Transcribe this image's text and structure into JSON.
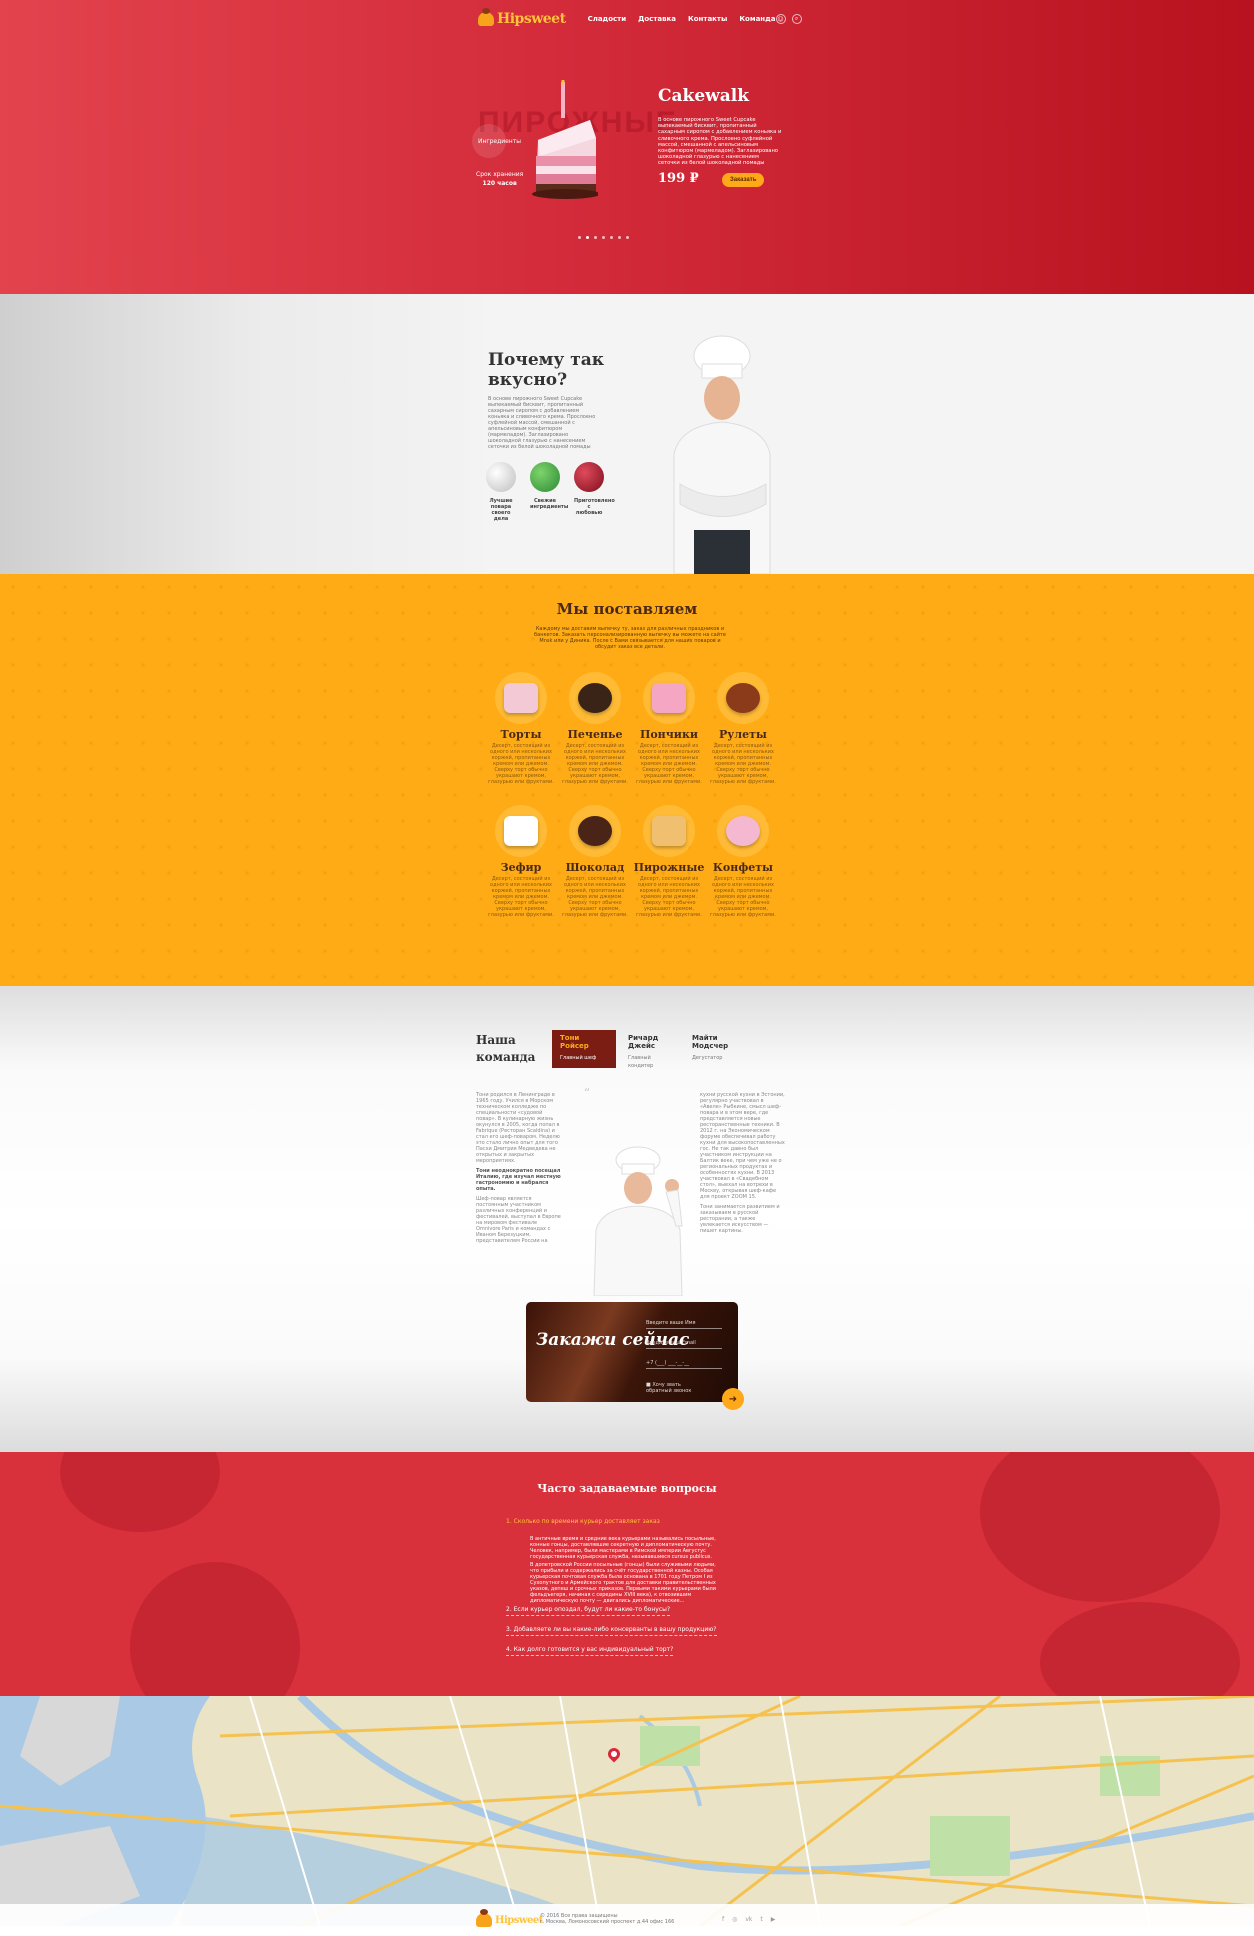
{
  "brand": {
    "name": "Hipsweet",
    "accent": "#ffa91a",
    "red": "#d32b3a",
    "orange": "#ffab16"
  },
  "nav": {
    "items": [
      "Сладости",
      "Доставка",
      "Контакты",
      "Команда"
    ],
    "icons": [
      "user-icon",
      "search-icon"
    ]
  },
  "hero": {
    "ghost_word": "ПИРОЖНЫЕ",
    "ingredients_label": "Ингредиенты",
    "shelf_label": "Срок хранения",
    "shelf_value": "120 часов",
    "title": "Cakewalk",
    "description": "В основе пирожного Sweet Cupcake выпекаемый бисквит, пропитанный сахарным сиропом с добавлением коньяка и сливочного крема. Прослоено суфлейной массой, смешанной с апельсиновым конфитюром (мармеладом). Заглазировано шоколадной глазурью с нанесением сеточки из белой шоколадной помады",
    "price": "199",
    "currency": "₽",
    "order_button": "Заказать",
    "slides": 7,
    "active_slide": 2
  },
  "why": {
    "title": "Почему так вкусно?",
    "text": "В основе пирожного Sweet Cupcake выпекаемый бисквит, пропитанный сахарным сиропом с добавлением коньяка и сливочного крема. Прослоено суфлейной массой, смешанной с апельсиновым конфитюром (мармеладом). Заглазировано шоколадной глазурью с нанесением сеточки из белой шоколадной помады",
    "features": [
      {
        "label": "Лучшие повара своего дела",
        "icon": "chef-hat-icon",
        "color": "#d7d7d7"
      },
      {
        "label": "Свежие ингредиенты",
        "icon": "leaf-icon",
        "color": "#3fae49"
      },
      {
        "label": "Приготовлено с любовью",
        "icon": "berry-icon",
        "color": "#a31a2a"
      }
    ]
  },
  "supply": {
    "title": "Мы поставляем",
    "subtitle": "Каждому мы доставим выпечку ту, заказ для различных праздников и банкетов. Заказать персонализированную выпечку вы можете на сайте Mnsk или у Диника. После с Вами связывается для наших поваров и обсудит заказ все детали.",
    "item_desc": "Десерт, состоящий из одного или нескольких коржей, пропитанных кремом или джемом. Сверху торт обычно украшают кремом, глазурью или фруктами.",
    "items": [
      {
        "name": "Торты",
        "icon": "cake-slice-icon"
      },
      {
        "name": "Печенье",
        "icon": "cookie-icon"
      },
      {
        "name": "Пончики",
        "icon": "donut-icon"
      },
      {
        "name": "Рулеты",
        "icon": "roll-icon"
      },
      {
        "name": "Зефир",
        "icon": "marshmallow-icon"
      },
      {
        "name": "Шоколад",
        "icon": "chocolate-icon"
      },
      {
        "name": "Пирожные",
        "icon": "cupcake-icon"
      },
      {
        "name": "Конфеты",
        "icon": "candy-icon"
      }
    ]
  },
  "team": {
    "title": "Наша команда",
    "members": [
      {
        "name": "Тони Ройсер",
        "role": "Главный шеф"
      },
      {
        "name": "Ричард Джейс",
        "role": "Главный кондитер"
      },
      {
        "name": "Майти Модсчер",
        "role": "Дегустатор"
      }
    ],
    "bio_left": "Тони родился в Ленинграде в 1965 году. Учился в Морском техническом колледже по специальности «судовой повар». В кулинарную жизнь окунулся в 2005, когда попал в Fabrique (Ресторан Scaldina) и стал его шеф-поваром. Неделю это стало лично опыт для того Пасхи Дмитрия Медведева не открытых и закрытых мероприятиях.",
    "bio_left_bold": "Тони неоднократно посещал Италию, где изучал местную гастрономию и набрался опыта.",
    "bio_left_2": "Шеф-повар является постоянным участником различных конференций и фестивалей, выступал в Европе на мировом фестивале Omnivore Paris и командах с Иваном Березуцким, представителем России на",
    "bio_right": "кухни русской кухни в Эстонии, регулярно участвовал в «Авеле» Рыбкине, смысл шеф-повара и в этом вере, где представляется новые ресторанственные техники. В 2012 г. на Экономическом форуме обеспечивал работу кухни для высокопоставленных гос. Не так давно был участником инструкции на Балтик веке, при чем уже не о региональных продуктах и особенностях кухни. В 2013 участвовал в «Свадебном стол», выехал на вотрехи в Москву, открывая шеф-кафе для проект ZOOM 15.",
    "bio_right_2": "Тони занимается развитием и заказываем в русской ресторании, а также увлекается искусством — пишет картины.",
    "order": {
      "title": "Закажи сейчас",
      "name_placeholder": "Введите ваше Имя",
      "email_placeholder": "Введите ваш Email",
      "phone_placeholder": "+7 (___) ___-__-__",
      "callback_label": "Хочу звать обратный звонок"
    }
  },
  "faq": {
    "title": "Часто задаваемые вопросы",
    "questions": [
      "1. Сколько по времени курьер доставляет заказ",
      "2. Если курьер опоздал, будут ли какие-то бонусы?",
      "3. Добавляете ли вы какие-либо консерванты в вашу продукцию?",
      "4. Как долго готовится у вас индивидуальный торт?"
    ],
    "answer_1": "В античные время и средние века курьерами назывались посыльные, конные гонцы, доставлявшие секретную и дипломатическую почту. Человек, например, были мастерами в Римской империи Августус государственная курьерская служба, называвшиеся cursus publicus.",
    "answer_2": "В допетровской России посыльные (гонцы) были служивыми людьми, что прибыли и содержались за счёт государственной казны. Особая курьерская почтовая служба была основана в 1701 году Петром I из Сухопутного и Армейского трактов для доставки правительственных указов, депеш и срочных приказов. Первыми такими курьерами были фельдъегеря, начиная с середины XVIII века), к отвозившим дипломатическую почту — двигались дипломатические..."
  },
  "footer": {
    "copyright": "© 2016 Все права защищены",
    "address": "г. Москва, Ломоносовский проспект д.44 офис 166",
    "social": [
      "facebook-icon",
      "instagram-icon",
      "vk-icon",
      "twitter-icon",
      "youtube-icon"
    ]
  }
}
